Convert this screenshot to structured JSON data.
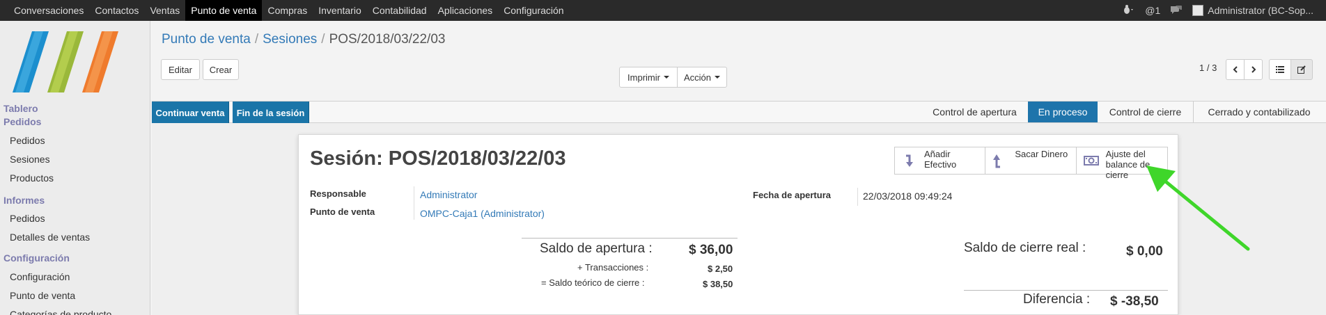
{
  "topbar": {
    "menu": [
      "Conversaciones",
      "Contactos",
      "Ventas",
      "Punto de venta",
      "Compras",
      "Inventario",
      "Contabilidad",
      "Aplicaciones",
      "Configuración"
    ],
    "active": "Punto de venta",
    "activity_icon": "bug-icon",
    "notifications": "@1",
    "chat_icon": "chat-icon",
    "user": "Administrator (BC-Sop..."
  },
  "sidebar": {
    "sections": [
      {
        "title": "Tablero",
        "items": []
      },
      {
        "title": "Pedidos",
        "items": [
          "Pedidos",
          "Sesiones",
          "Productos"
        ]
      },
      {
        "title": "Informes",
        "items": [
          "Pedidos",
          "Detalles de ventas"
        ]
      },
      {
        "title": "Configuración",
        "items": [
          "Configuración",
          "Punto de venta",
          "Categorías de producto"
        ]
      }
    ]
  },
  "breadcrumb": {
    "items": [
      "Punto de venta",
      "Sesiones"
    ],
    "current": "POS/2018/03/22/03"
  },
  "toolbar": {
    "edit": "Editar",
    "create": "Crear",
    "print": "Imprimir",
    "action": "Acción"
  },
  "pager": {
    "text": "1 / 3"
  },
  "statusbar": {
    "buttons": [
      "Continuar venta",
      "Fin de la sesión"
    ],
    "stages": [
      "Control de apertura",
      "En proceso",
      "Control de cierre",
      "Cerrado y contabilizado"
    ],
    "active_stage": "En proceso"
  },
  "session": {
    "title": "Sesión: POS/2018/03/22/03",
    "stat_buttons": [
      {
        "label": "Añadir Efectivo",
        "icon": "cash-in-icon"
      },
      {
        "label": "Sacar Dinero",
        "icon": "cash-out-icon"
      },
      {
        "label": "Ajuste del balance de cierre",
        "icon": "money-icon"
      }
    ],
    "fields": {
      "responsible_label": "Responsable",
      "responsible_value": "Administrator",
      "pos_label": "Punto de venta",
      "pos_value": "OMPC-Caja1 (Administrator)",
      "opening_date_label": "Fecha de apertura",
      "opening_date_value": "22/03/2018 09:49:24"
    },
    "summary": {
      "opening_balance_label": "Saldo de apertura :",
      "opening_balance_value": "$ 36,00",
      "transactions_label": "+ Transacciones :",
      "transactions_value": "$ 2,50",
      "theoretical_label": "= Saldo teórico de cierre :",
      "theoretical_value": "$ 38,50",
      "real_closing_label": "Saldo de cierre real :",
      "real_closing_value": "$ 0,00",
      "difference_label": "Diferencia :",
      "difference_value": "$ -38,50"
    }
  },
  "colors": {
    "brand": "#7c7bad",
    "primary": "#1a75a8",
    "link": "#337ab7",
    "annotation_arrow": "#3fd62a"
  }
}
